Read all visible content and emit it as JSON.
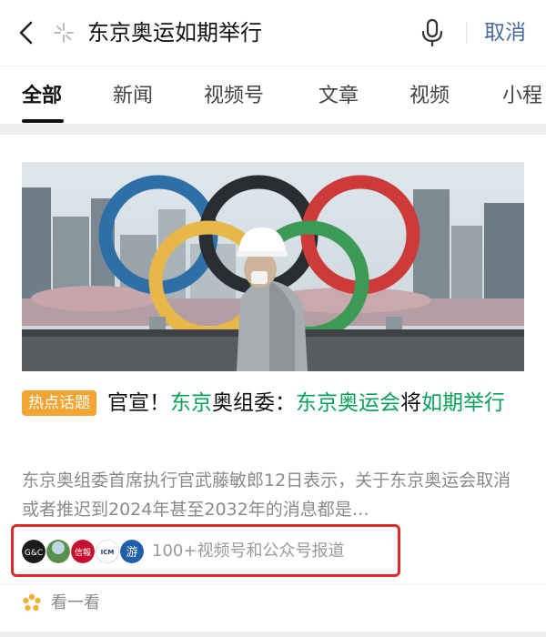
{
  "search": {
    "query": "东京奥运如期举行",
    "cancel_label": "取消"
  },
  "tabs": [
    {
      "label": "全部",
      "active": true
    },
    {
      "label": "新闻"
    },
    {
      "label": "视频号"
    },
    {
      "label": "文章"
    },
    {
      "label": "视频"
    },
    {
      "label": "小程"
    }
  ],
  "result": {
    "tag": "热点话题",
    "headline": [
      {
        "text": "官宣！",
        "style": "black"
      },
      {
        "text": "东京",
        "style": "green"
      },
      {
        "text": "奥组委：",
        "style": "black"
      },
      {
        "text": "东京奥运会",
        "style": "green"
      },
      {
        "text": "将",
        "style": "black"
      },
      {
        "text": "如期举行",
        "style": "green"
      }
    ],
    "snippet": "东京奥组委首席执行官武藤敏郎12日表示，关于东京奥运会取消或者推迟到2024年甚至2032年的消息都是…",
    "source_avatars": [
      {
        "text": "G&C",
        "color": "#1a1a1a"
      },
      {
        "text": "",
        "color": "#5a8f4a"
      },
      {
        "text": "信報",
        "color": "#c8102e"
      },
      {
        "text": "ICM",
        "color": "#ffffff"
      },
      {
        "text": "游",
        "color": "#1f5ea8"
      }
    ],
    "sources_label": "100+视频号和公众号报道",
    "see_more_label": "看一看"
  },
  "colors": {
    "highlight_green": "#07a05a",
    "tag_orange": "#f3a533",
    "cancel_blue": "#4a6a9a",
    "annotation_red": "#e02a2a"
  },
  "icons": [
    "back-icon",
    "sparkle-icon",
    "microphone-icon",
    "look-icon"
  ]
}
